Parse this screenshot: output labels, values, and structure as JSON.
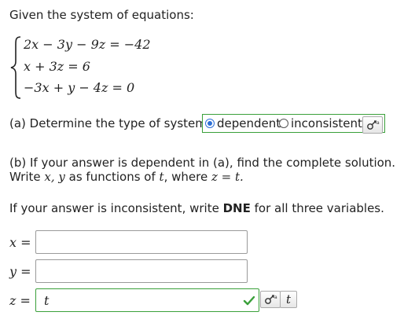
{
  "intro": "Given the system of equations:",
  "system": {
    "eq1": "2x − 3y − 9z = −42",
    "eq2": "x + 3z = 6",
    "eq3": "−3x + y − 4z = 0"
  },
  "part_a": {
    "prompt": "(a) Determine the type of system:",
    "options": [
      "dependent",
      "inconsistent"
    ],
    "selected": "dependent"
  },
  "part_b": {
    "line1": "(b) If your answer is dependent in (a), find the complete solution.",
    "line2_prefix": "Write",
    "line2_vars": "x, y",
    "line2_mid": "as functions of",
    "line2_t": "t",
    "line2_where": ", where",
    "line2_eq": "z = t.",
    "line3_prefix": "If your answer is inconsistent, write",
    "line3_bold": "DNE",
    "line3_suffix": "for all three variables."
  },
  "answers": {
    "x_label": "x =",
    "y_label": "y =",
    "z_label": "z =",
    "x_value": "",
    "y_value": "",
    "z_value": "t",
    "z_status": "correct",
    "t_label": "t"
  },
  "icons": {
    "tool": "math-tool-icon",
    "check": "check-icon"
  },
  "colors": {
    "correct_green": "#3aa03a",
    "radio_blue": "#2d6fd6"
  }
}
